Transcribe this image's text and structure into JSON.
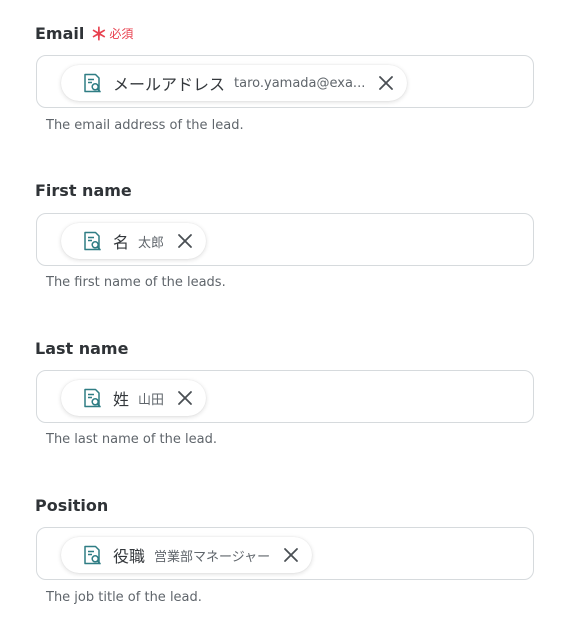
{
  "fields": [
    {
      "label": "Email",
      "required_mark": "＊",
      "required_text": "必須",
      "chip_label": "メールアドレス",
      "chip_value": "taro.yamada@exa...",
      "help": "The email address of the lead."
    },
    {
      "label": "First name",
      "chip_label": "名",
      "chip_value": "太郎",
      "help": "The first name of the leads."
    },
    {
      "label": "Last name",
      "chip_label": "姓",
      "chip_value": "山田",
      "help": "The last name of the lead."
    },
    {
      "label": "Position",
      "chip_label": "役職",
      "chip_value": "営業部マネージャー",
      "help": "The job title of the lead."
    }
  ],
  "icons": {
    "chip_icon": "document-search-icon",
    "remove_icon": "close-icon"
  },
  "colors": {
    "required": "#e8414f",
    "chip_icon": "#2f7d84",
    "border": "#d6dadd"
  }
}
